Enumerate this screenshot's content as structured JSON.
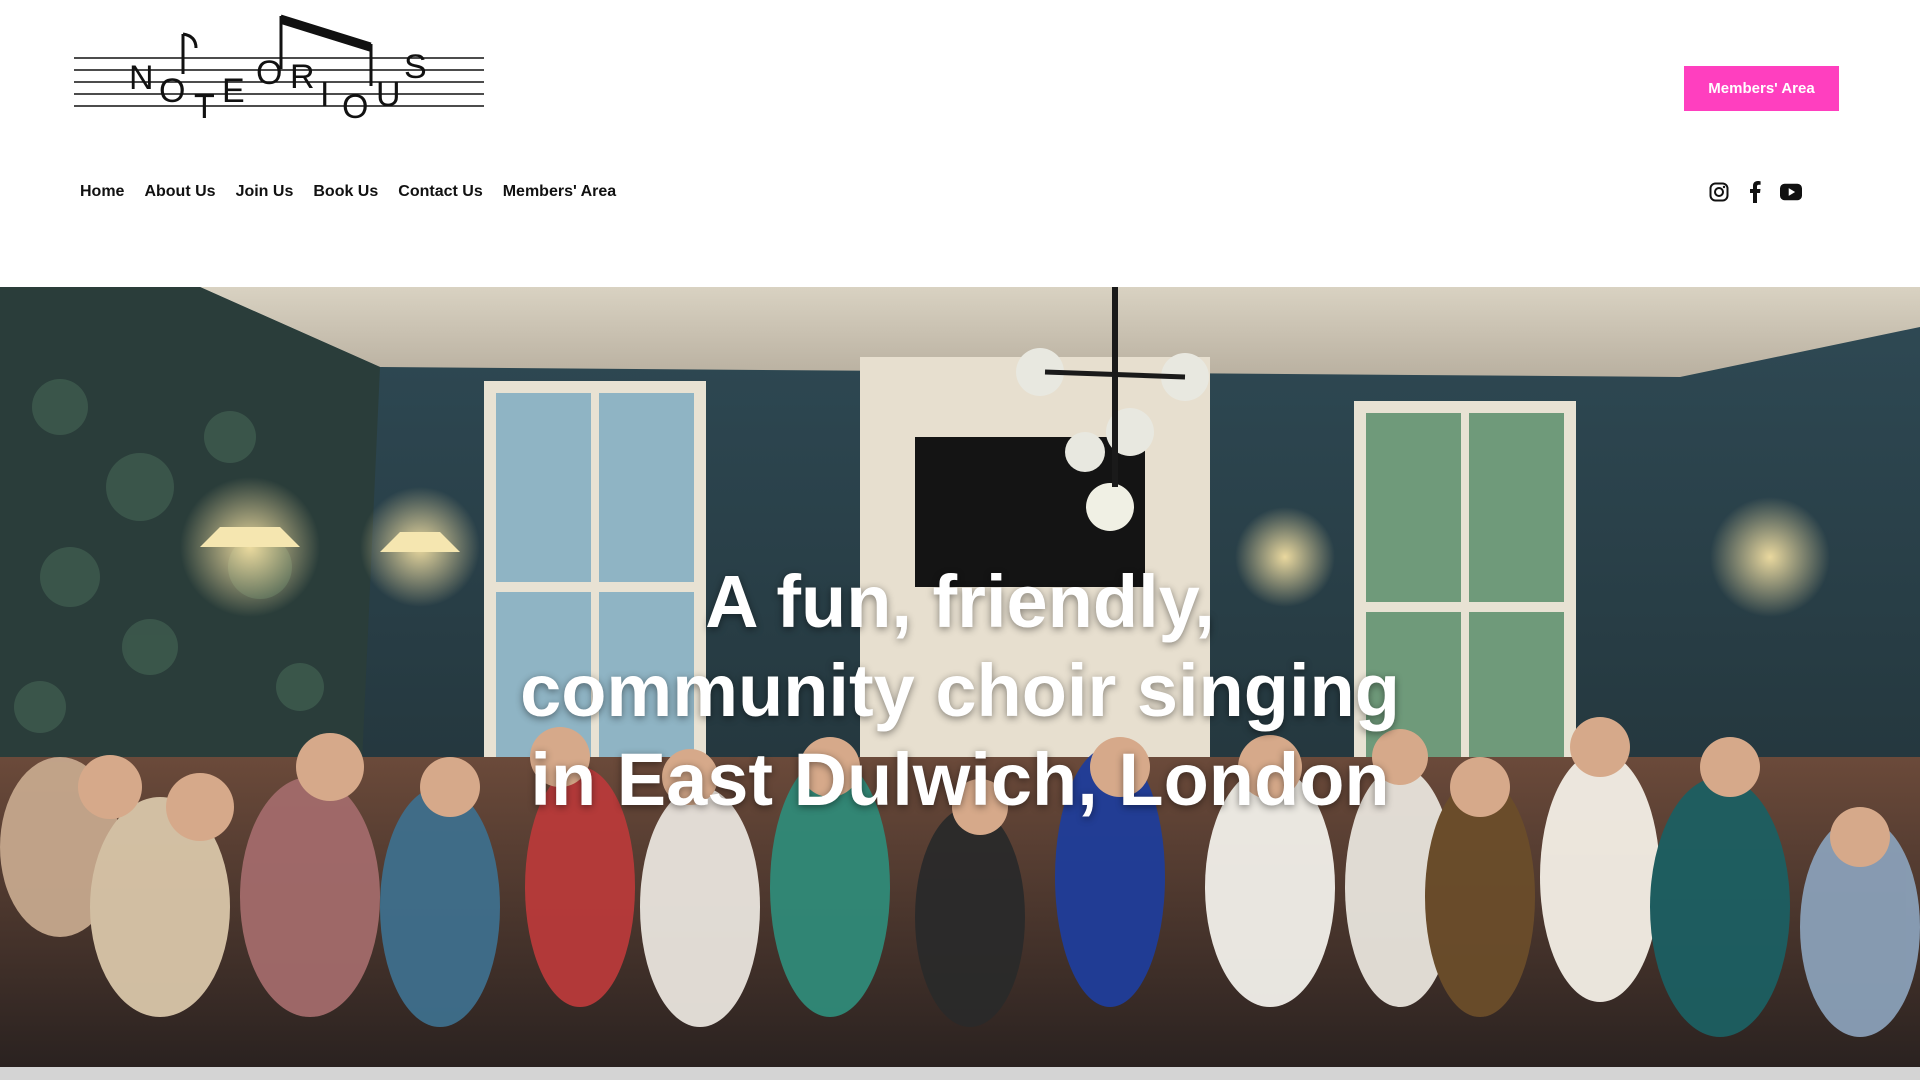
{
  "brand": {
    "logo_letters": [
      "N",
      "O",
      "T",
      "E",
      "O",
      "R",
      "I",
      "O",
      "U",
      "S"
    ],
    "accent_color": "#ff3fbf"
  },
  "header": {
    "cta_label": "Members' Area"
  },
  "nav": {
    "items": [
      {
        "label": "Home"
      },
      {
        "label": "About Us"
      },
      {
        "label": "Join Us"
      },
      {
        "label": "Book Us"
      },
      {
        "label": "Contact Us"
      },
      {
        "label": "Members' Area"
      }
    ]
  },
  "social": {
    "icons": [
      "instagram-icon",
      "facebook-icon",
      "youtube-icon"
    ]
  },
  "hero": {
    "title_lines": [
      "A fun, friendly,",
      "community choir singing",
      "in East Dulwich, London"
    ]
  }
}
